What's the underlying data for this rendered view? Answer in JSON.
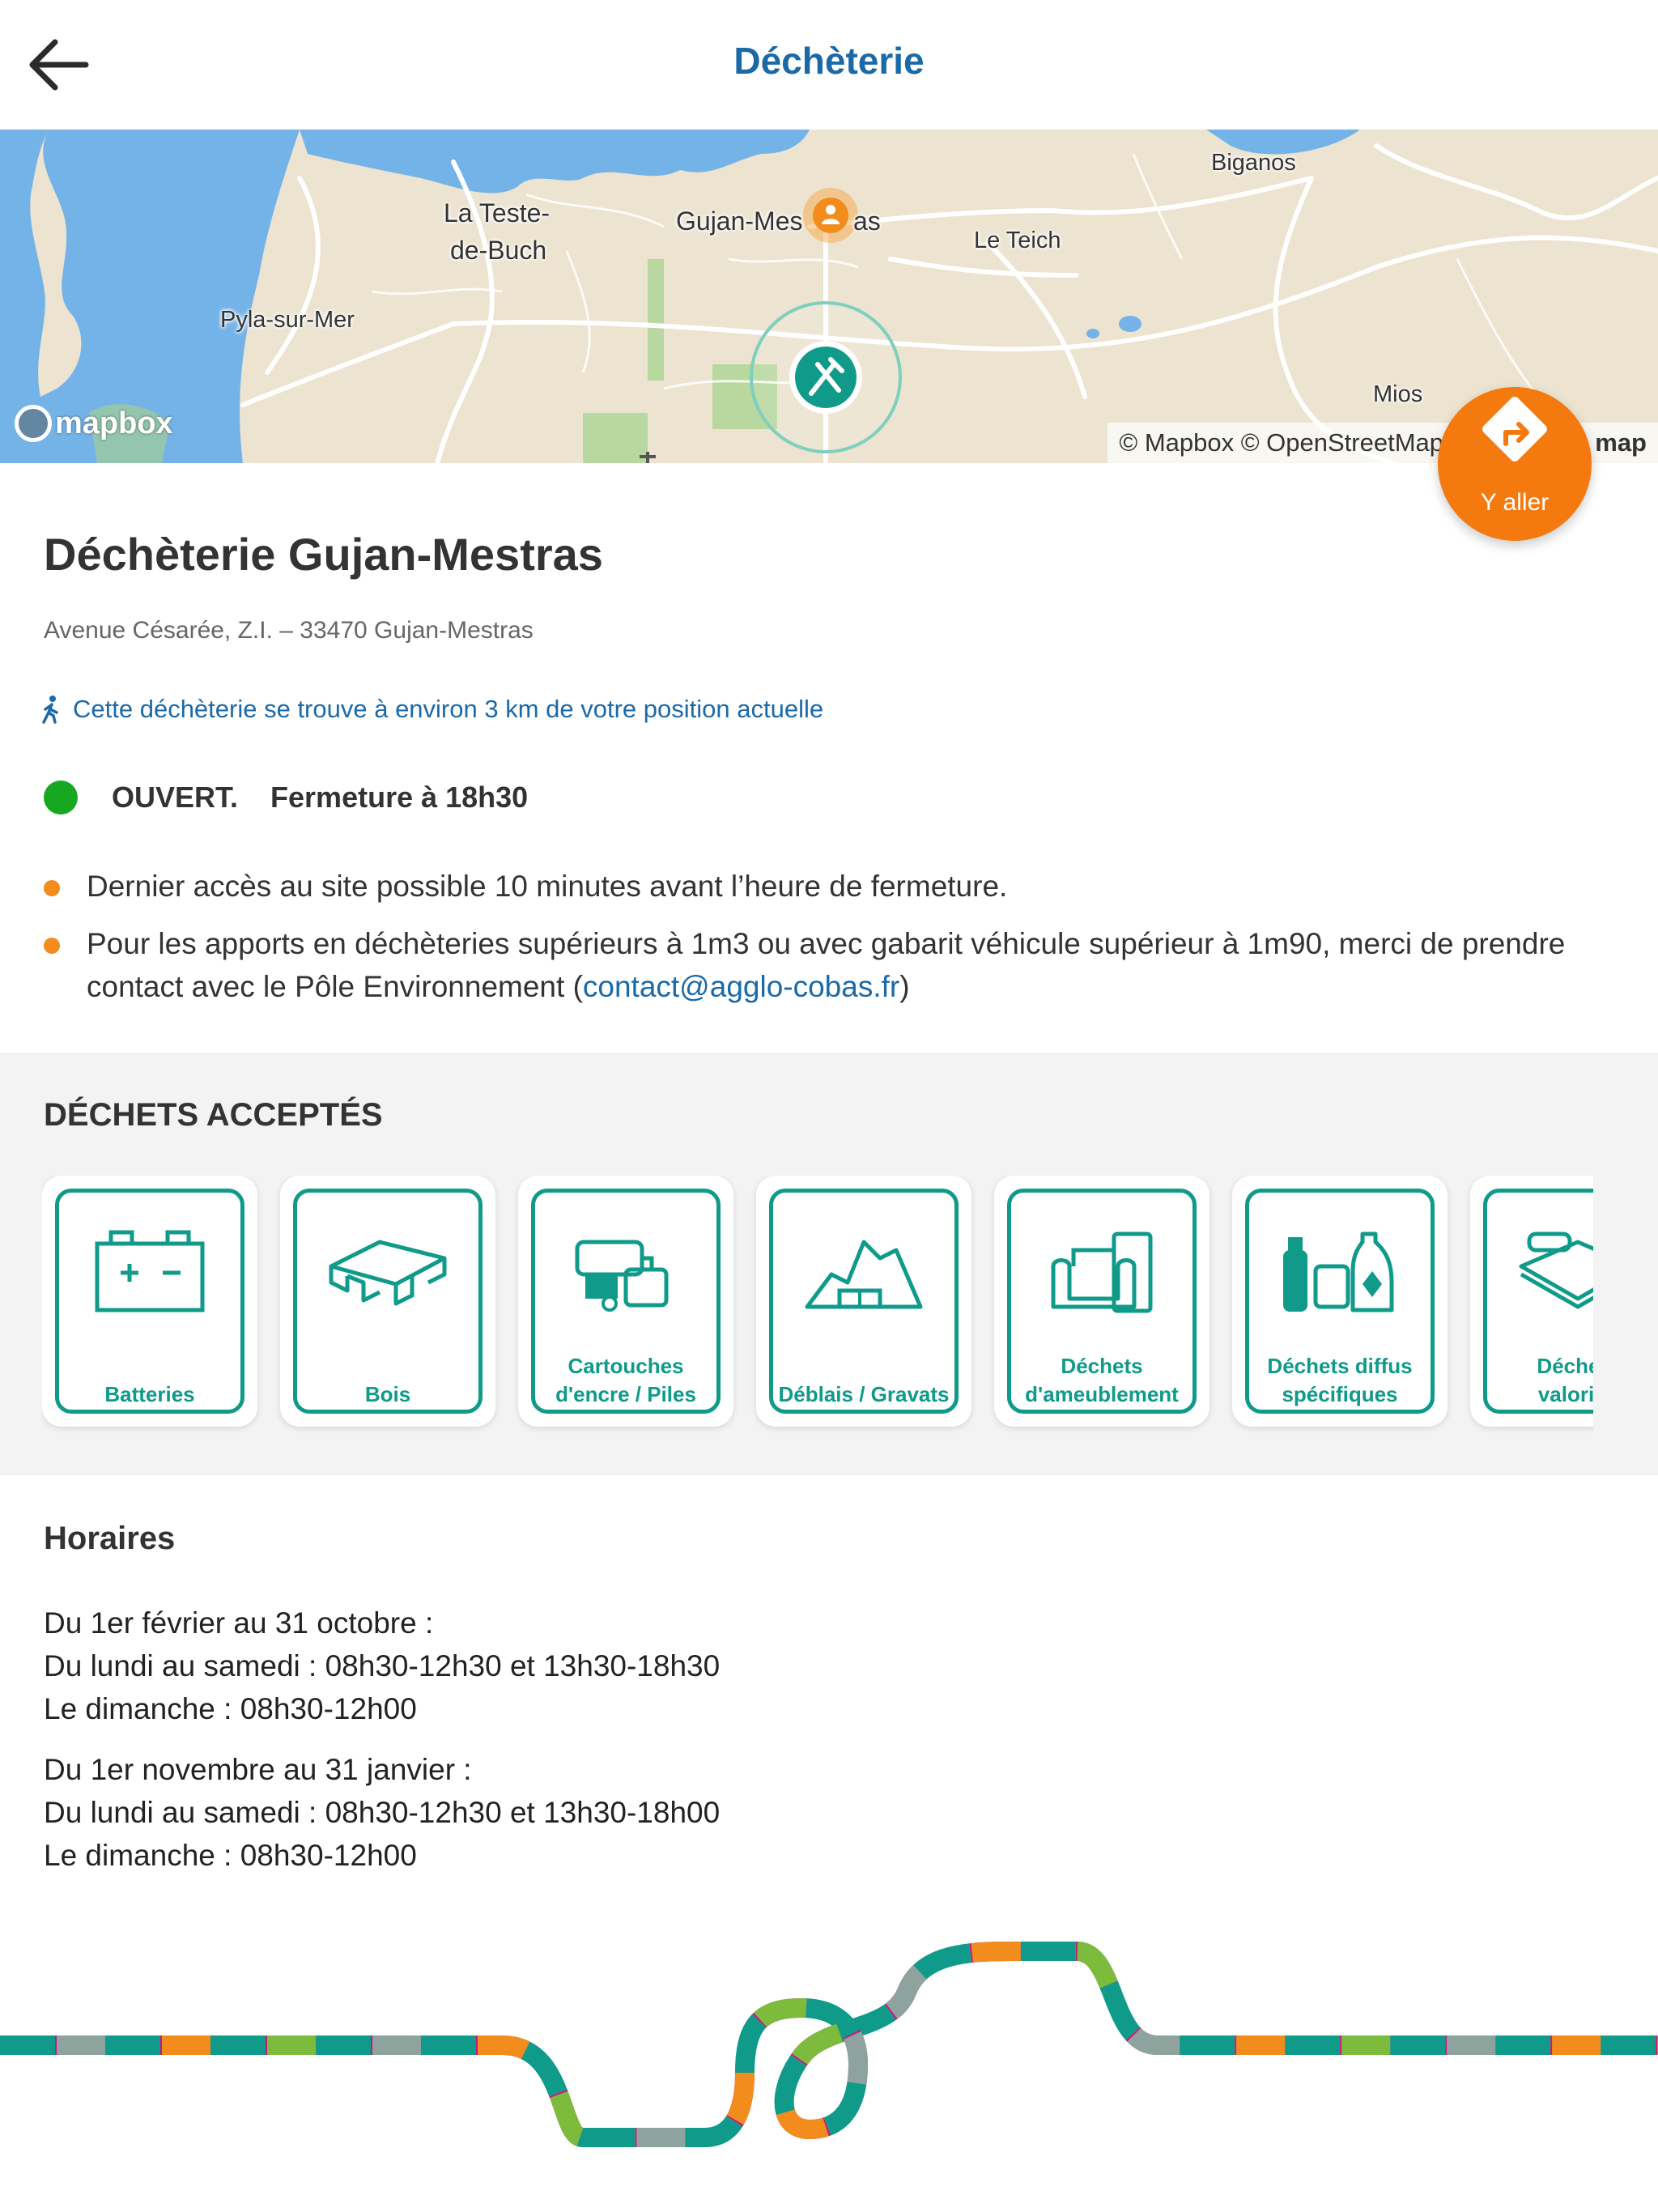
{
  "header": {
    "title": "Déchèterie",
    "back_icon": "arrow-left-icon"
  },
  "map": {
    "labels": {
      "la_teste_1": "La Teste-",
      "la_teste_2": "de-Buch",
      "gujan": "Gujan-Mes",
      "gujan_end": "as",
      "le_teich": "Le Teich",
      "biganos": "Biganos",
      "pyla": "Pyla-sur-Mer",
      "mios": "Mios"
    },
    "logo": "mapbox",
    "attribution": "© Mapbox © OpenStreetMap  I",
    "attribution_end": "map"
  },
  "go_button": {
    "label": "Y aller",
    "icon": "turn-right-icon",
    "color": "#f47a10"
  },
  "site": {
    "name": "Déchèterie Gujan-Mestras",
    "address": "Avenue Césarée, Z.I. – 33470 Gujan-Mestras",
    "distance": "Cette déchèterie se trouve à environ 3 km de votre position actuelle",
    "status": "OUVERT.",
    "closing": "Fermeture à 18h30",
    "status_color": "#16a821"
  },
  "notes": {
    "first": "Dernier accès au site possible 10 minutes avant l’heure de fermeture.",
    "second": "Pour les apports en déchèteries supérieurs à 1m3 ou avec gabarit véhicule supérieur à 1m90, merci de prendre contact avec le Pôle Environnement (",
    "email": "contact@agglo-cobas.fr",
    "second_end": ")"
  },
  "accepted": {
    "title": "DÉCHETS ACCEPTÉS",
    "items": [
      {
        "label": "Batteries",
        "icon": "battery-icon"
      },
      {
        "label": "Bois",
        "icon": "pallet-icon"
      },
      {
        "label": "Cartouches d'encre / Piles",
        "icon": "cartridge-icon"
      },
      {
        "label": "Déblais / Gravats",
        "icon": "rubble-icon"
      },
      {
        "label": "Déchets d'ameublement",
        "icon": "furniture-icon"
      },
      {
        "label": "Déchets diffus spécifiques",
        "icon": "chemicals-icon"
      },
      {
        "label": "Déchets valorisa",
        "icon": "paper-icon"
      }
    ],
    "accent": "#0f9a8a"
  },
  "hours": {
    "title": "Horaires",
    "period1": {
      "heading": "Du 1er février au 31 octobre :",
      "weekdays": "Du lundi au samedi : 08h30-12h30 et 13h30-18h30",
      "sunday": "Le dimanche : 08h30-12h00"
    },
    "period2": {
      "heading": "Du 1er novembre au 31 janvier :",
      "weekdays": "Du lundi au samedi : 08h30-12h30 et 13h30-18h00",
      "sunday": "Le dimanche : 08h30-12h00"
    }
  }
}
